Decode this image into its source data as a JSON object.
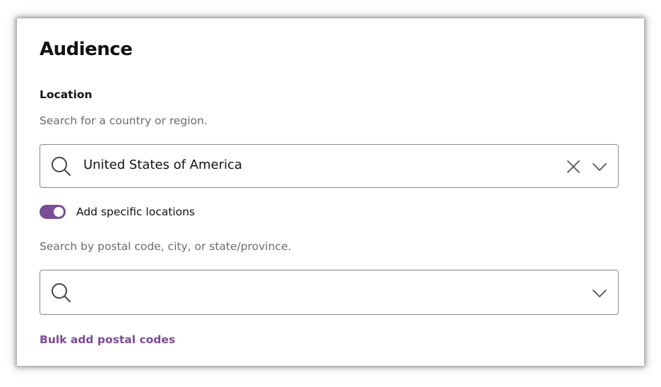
{
  "audience": {
    "title": "Audience",
    "location": {
      "label": "Location",
      "hint": "Search for a country or region.",
      "value": "United States of America",
      "icons": [
        "search-icon",
        "close-icon",
        "chevron-down-icon"
      ]
    },
    "specific_locations": {
      "toggle_label": "Add specific locations",
      "toggle_on": true,
      "hint": "Search by postal code, city, or state/province.",
      "value": "",
      "placeholder": "",
      "icons": [
        "search-icon",
        "chevron-down-icon"
      ]
    },
    "bulk_link": "Bulk add postal codes"
  },
  "colors": {
    "accent": "#7b4a95",
    "toggle_on": "#7a4f95",
    "text_primary": "#111111",
    "text_secondary": "#6b6b6b",
    "border": "#8a8a8a"
  }
}
